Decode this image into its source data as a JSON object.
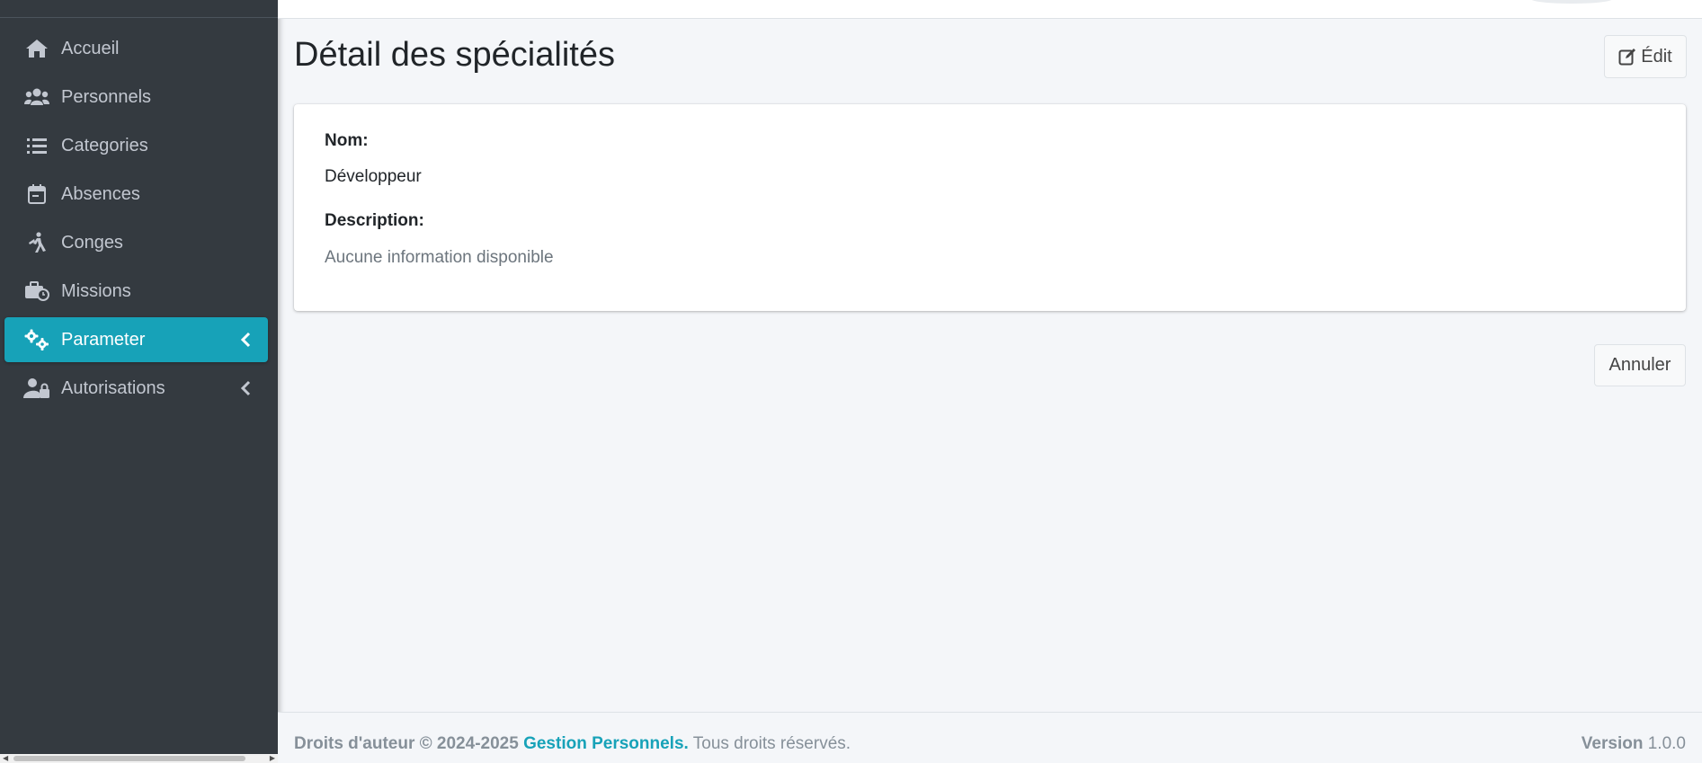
{
  "sidebar": {
    "items": [
      {
        "label": "Accueil",
        "icon": "home-icon"
      },
      {
        "label": "Personnels",
        "icon": "users-icon"
      },
      {
        "label": "Categories",
        "icon": "list-icon"
      },
      {
        "label": "Absences",
        "icon": "calendar-icon"
      },
      {
        "label": "Conges",
        "icon": "walking-icon"
      },
      {
        "label": "Missions",
        "icon": "briefcase-clock-icon"
      },
      {
        "label": "Parameter",
        "icon": "cogs-icon",
        "active": true
      },
      {
        "label": "Autorisations",
        "icon": "user-lock-icon"
      }
    ]
  },
  "page": {
    "title": "Détail des spécialités",
    "edit_label": "Édit"
  },
  "details": {
    "name_label": "Nom:",
    "name_value": "Développeur",
    "description_label": "Description:",
    "description_value": "Aucune information disponible"
  },
  "actions": {
    "cancel_label": "Annuler"
  },
  "footer": {
    "copyright": "Droits d'auteur © 2024-2025",
    "brand": "Gestion Personnels.",
    "rights": "Tous droits réservés.",
    "version_label": "Version",
    "version_value": "1.0.0"
  },
  "colors": {
    "sidebar_bg": "#343a40",
    "accent": "#17a2b8",
    "content_bg": "#f4f6f9"
  }
}
